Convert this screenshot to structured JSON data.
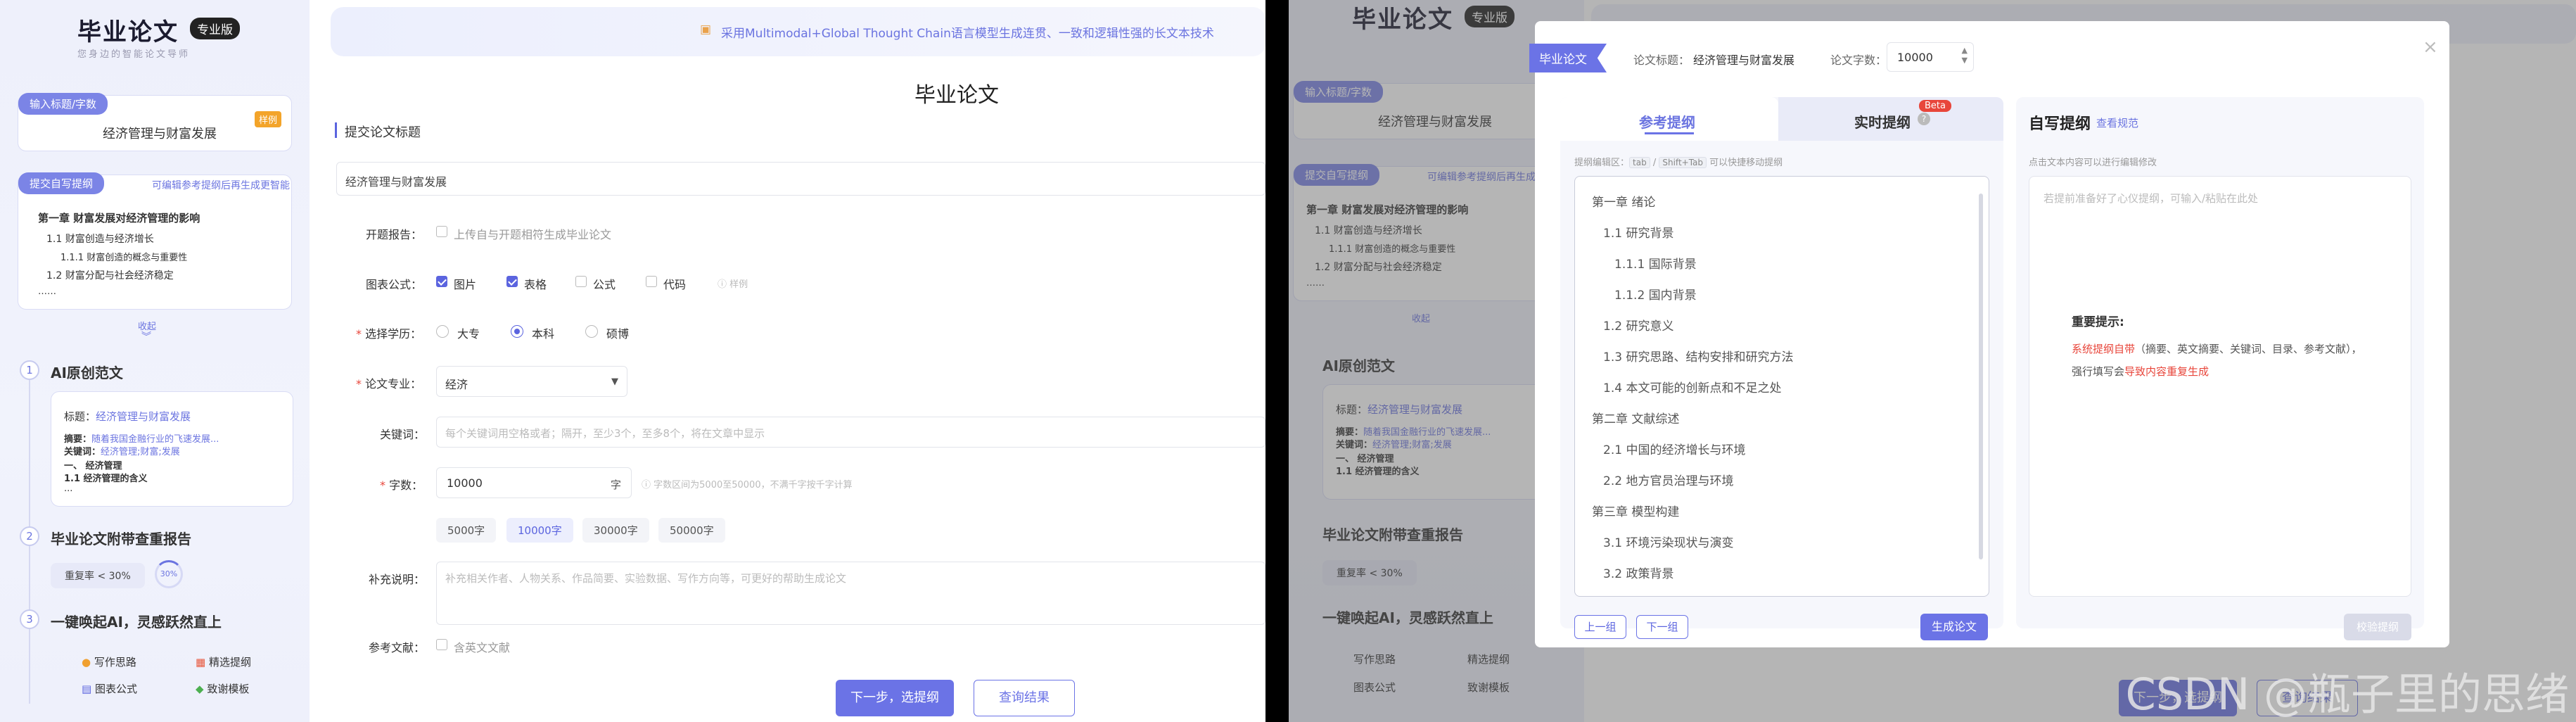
{
  "brand": {
    "title": "毕业论文",
    "badge": "专业版",
    "slogan": "您身边的智能论文导师"
  },
  "sidebar": {
    "input_pill": "输入标题/字数",
    "sample_tag": "样例",
    "title_value": "经济管理与财富发展",
    "outline_pill": "提交自写提纲",
    "outline_hint": "可编辑参考提纲后再生成更智能",
    "outline_lines": [
      "第一章 财富发展对经济管理的影响",
      "1.1 财富创造与经济增长",
      "1.1.1 财富创造的概念与重要性",
      "1.2 财富分配与社会经济稳定",
      "……"
    ],
    "collapse_label": "收起",
    "step1": {
      "num": "1",
      "title": "AI原创范文",
      "title_label": "标题：",
      "title_val": "经济管理与财富发展",
      "abs_label": "摘要：",
      "abs_val": "随着我国金融行业的飞速发展...",
      "kw_label": "关键词：",
      "kw_val": "经济管理;财富;发展",
      "line1": "一、 经济管理",
      "line2": "1.1 经济管理的含义",
      "line3": "..."
    },
    "step2": {
      "num": "2",
      "title": "毕业论文附带查重报告",
      "dup_label": "重复率 < 30%",
      "dup_ring": "30%"
    },
    "step3": {
      "num": "3",
      "title": "一键唤起AI，灵感跃然直上",
      "items": [
        "写作思路",
        "精选提纲",
        "图表公式",
        "致谢模板"
      ]
    }
  },
  "banner": {
    "text": "采用Multimodal+Global Thought Chain语言模型生成连贯、一致和逻辑性强的长文本技术"
  },
  "form": {
    "heading": "毕业论文",
    "section": "提交论文标题",
    "title_value": "经济管理与财富发展",
    "kaiti_label": "开题报告：",
    "kaiti_option": "上传自与开题相符生成毕业论文",
    "chart_label": "图表公式：",
    "chart_options": [
      "图片",
      "表格",
      "公式",
      "代码"
    ],
    "chart_sample": "样例",
    "edu_label": "选择学历：",
    "edu_options": [
      "大专",
      "本科",
      "硕博"
    ],
    "major_label": "论文专业：",
    "major_value": "经济",
    "kw_label": "关键词：",
    "kw_placeholder": "每个关键词用空格或者；隔开，至少3个，至多8个，将在文章中显示",
    "words_label": "字数：",
    "words_value": "10000",
    "words_unit": "字",
    "words_hint": "字数区间为5000至50000，不满千字按千字计算",
    "word_chips": [
      "5000字",
      "10000字",
      "30000字",
      "50000字"
    ],
    "extra_label": "补充说明：",
    "extra_placeholder": "补充相关作者、人物关系、作品简要、实验数据、写作方向等，可更好的帮助生成论文",
    "ref_label": "参考文献：",
    "ref_option": "含英文文献",
    "next_btn": "下一步，选提纲",
    "query_btn": "查询结果"
  },
  "modal": {
    "tab_tag": "毕业论文",
    "title_label": "论文标题：",
    "title_value": "经济管理与财富发展",
    "words_label": "论文字数：",
    "words_value": "10000",
    "tab_ref": "参考提纲",
    "tab_live": "实时提纲",
    "beta": "Beta",
    "edit_hint_prefix": "提纲编辑区：",
    "key1": "tab",
    "key_sep": "/",
    "key2": "Shift+Tab",
    "edit_hint_suffix": "可以快捷移动提纲",
    "outline": [
      "第一章 绪论",
      "1.1 研究背景",
      "1.1.1 国际背景",
      "1.1.2 国内背景",
      "1.2 研究意义",
      "1.3 研究思路、结构安排和研究方法",
      "1.4 本文可能的创新点和不足之处",
      "第二章 文献综述",
      "2.1 中国的经济增长与环境",
      "2.2 地方官员治理与环境",
      "第三章 模型构建",
      "3.1 环境污染现状与演变",
      "3.2 政策背景"
    ],
    "prev_btn": "上一组",
    "next_btn": "下一组",
    "gen_btn": "生成论文",
    "self_title": "自写提纲",
    "self_link": "查看规范",
    "self_hint": "点击文本内容可以进行编辑修改",
    "self_placeholder": "若提前准备好了心仪提纲，可输入/粘贴在此处",
    "tip_title": "重要提示:",
    "tip_red": "系统提纲自带",
    "tip_rest": "（摘要、英文摘要、关键词、目录、参考文献），",
    "tip_line2_pre": "强行填写会",
    "tip_line2_red": "导致内容重复生成",
    "check_btn": "校验提纲"
  },
  "watermark": "CSDN @瓶子里的思绪"
}
